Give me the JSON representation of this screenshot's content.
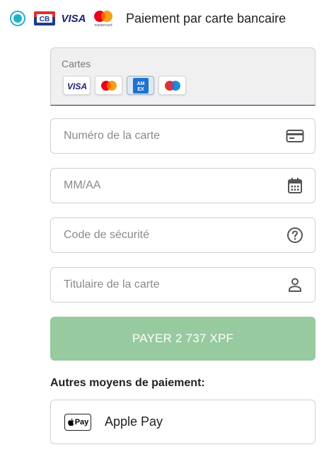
{
  "header": {
    "title": "Paiement par carte bancaire",
    "selected": true,
    "logos": [
      "cb-logo",
      "visa-logo",
      "mastercard-logo"
    ],
    "visa_text": "VISA",
    "cb_text": "CB",
    "mastercard_text": "mastercard",
    "accent_color": "#22b0c9"
  },
  "cards": {
    "label": "Cartes",
    "chips": [
      {
        "name": "visa",
        "text": "VISA",
        "selected": false
      },
      {
        "name": "mastercard",
        "text": "",
        "selected": false
      },
      {
        "name": "amex",
        "text": "AM EX",
        "selected": true
      },
      {
        "name": "maestro",
        "text": "",
        "selected": false
      }
    ]
  },
  "fields": {
    "card_number": {
      "placeholder": "Numéro de la carte",
      "icon": "credit-card-icon"
    },
    "expiry": {
      "placeholder": "MM/AA",
      "icon": "calendar-icon"
    },
    "security_code": {
      "placeholder": "Code de sécurité",
      "icon": "help-circle-icon"
    },
    "holder": {
      "placeholder": "Titulaire de la carte",
      "icon": "person-icon"
    }
  },
  "pay_button": {
    "label": "PAYER 2 737 XPF",
    "color": "#97ca9f"
  },
  "other_methods": {
    "title": "Autres moyens de paiement:",
    "items": [
      {
        "label": "Apple Pay",
        "badge": "Pay",
        "icon": "apple-pay-icon"
      }
    ]
  }
}
